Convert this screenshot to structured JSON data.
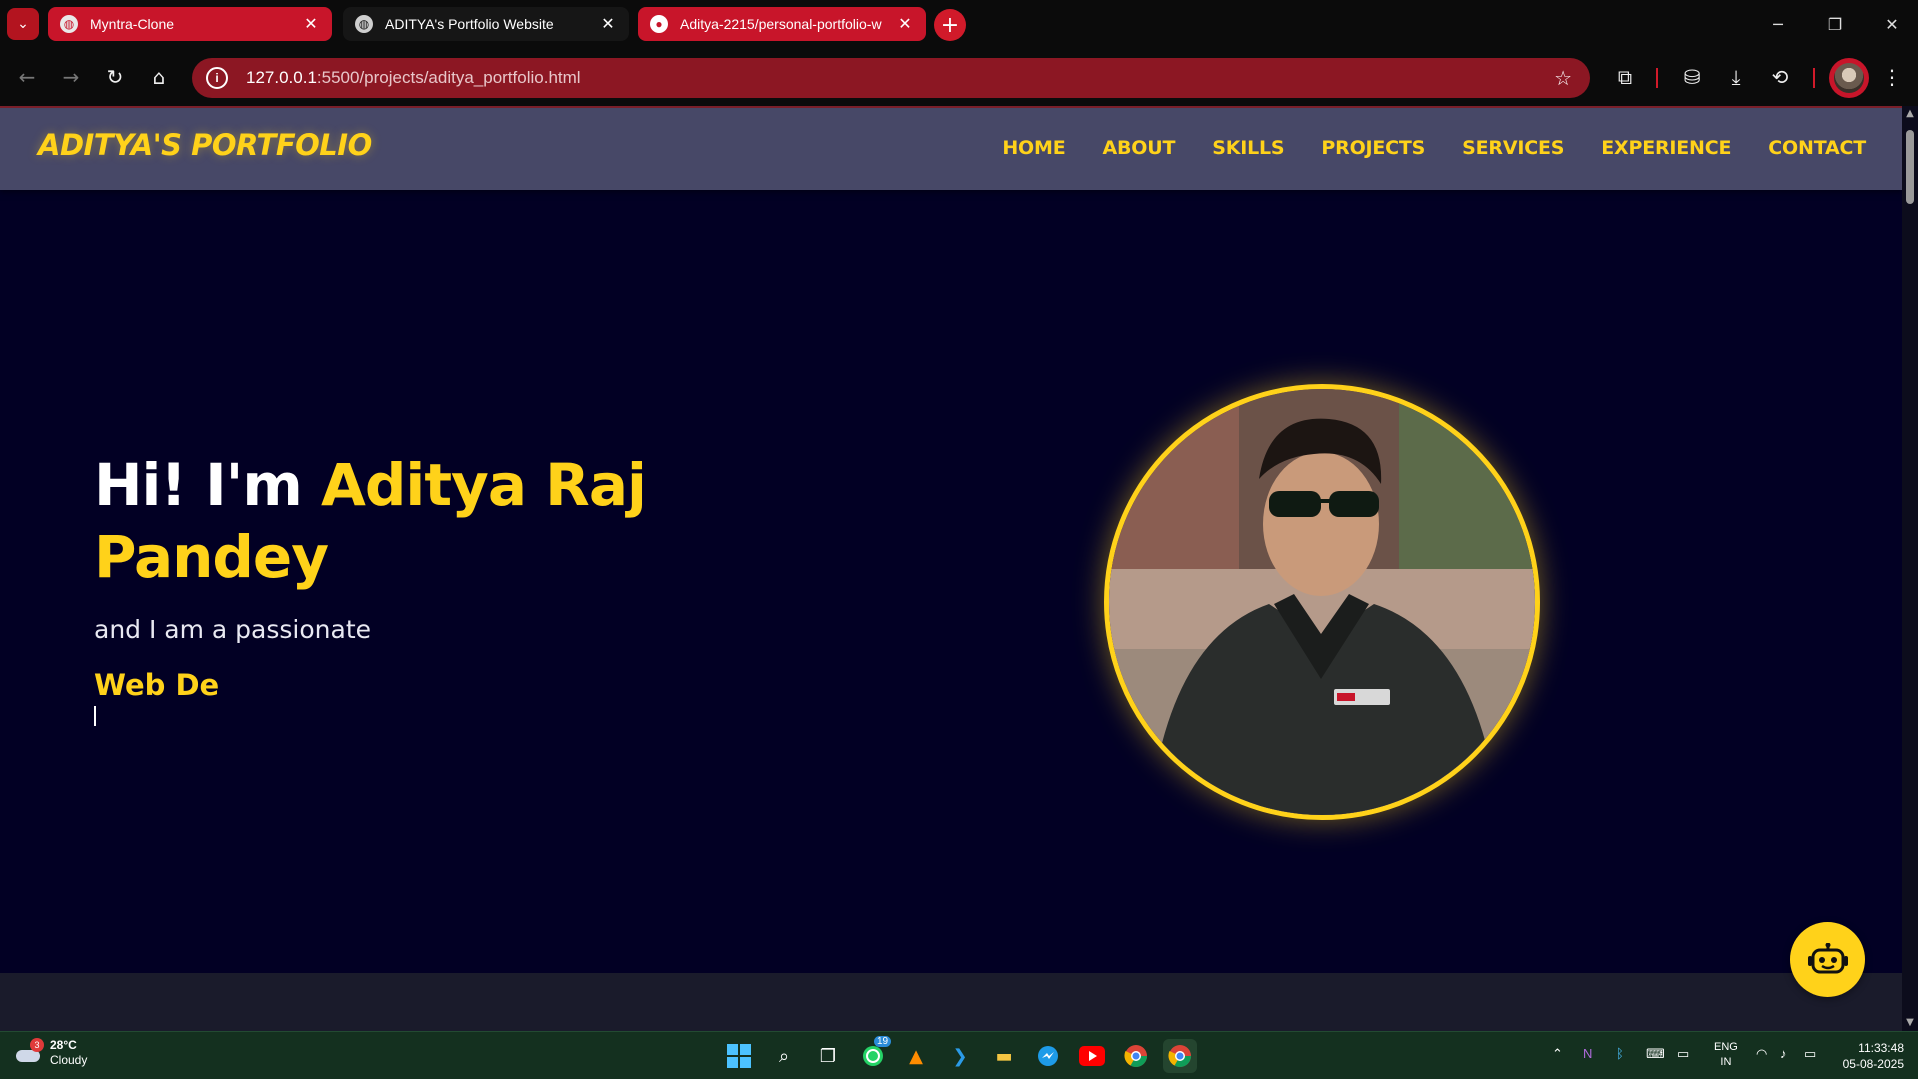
{
  "browser": {
    "tabs": [
      {
        "title": "Myntra-Clone",
        "close": "✕"
      },
      {
        "title": "ADITYA's Portfolio Website",
        "close": "✕"
      },
      {
        "title": "Aditya-2215/personal-portfolio-w",
        "close": "✕"
      }
    ],
    "new_tab": "+",
    "url_host": "127.0.0.1",
    "url_path": ":5500/projects/aditya_portfolio.html"
  },
  "site": {
    "logo": "ADITYA'S PORTFOLIO",
    "nav": [
      "HOME",
      "ABOUT",
      "SKILLS",
      "PROJECTS",
      "SERVICES",
      "EXPERIENCE",
      "CONTACT"
    ],
    "hero": {
      "greeting": "Hi! I'm ",
      "name": "Aditya Raj Pandey",
      "subtitle": "and I am a passionate",
      "typed": "Web De"
    }
  },
  "taskbar": {
    "weather_badge": "3",
    "temp": "28°C",
    "condition": "Cloudy",
    "whatsapp_badge": "19",
    "lang_top": "ENG",
    "lang_bottom": "IN",
    "time": "11:33:48",
    "date": "05-08-2025"
  },
  "colors": {
    "accent": "#ffd21a",
    "page_bg": "#020024",
    "header_bg": "#474867",
    "browser_red": "#c8152a"
  }
}
